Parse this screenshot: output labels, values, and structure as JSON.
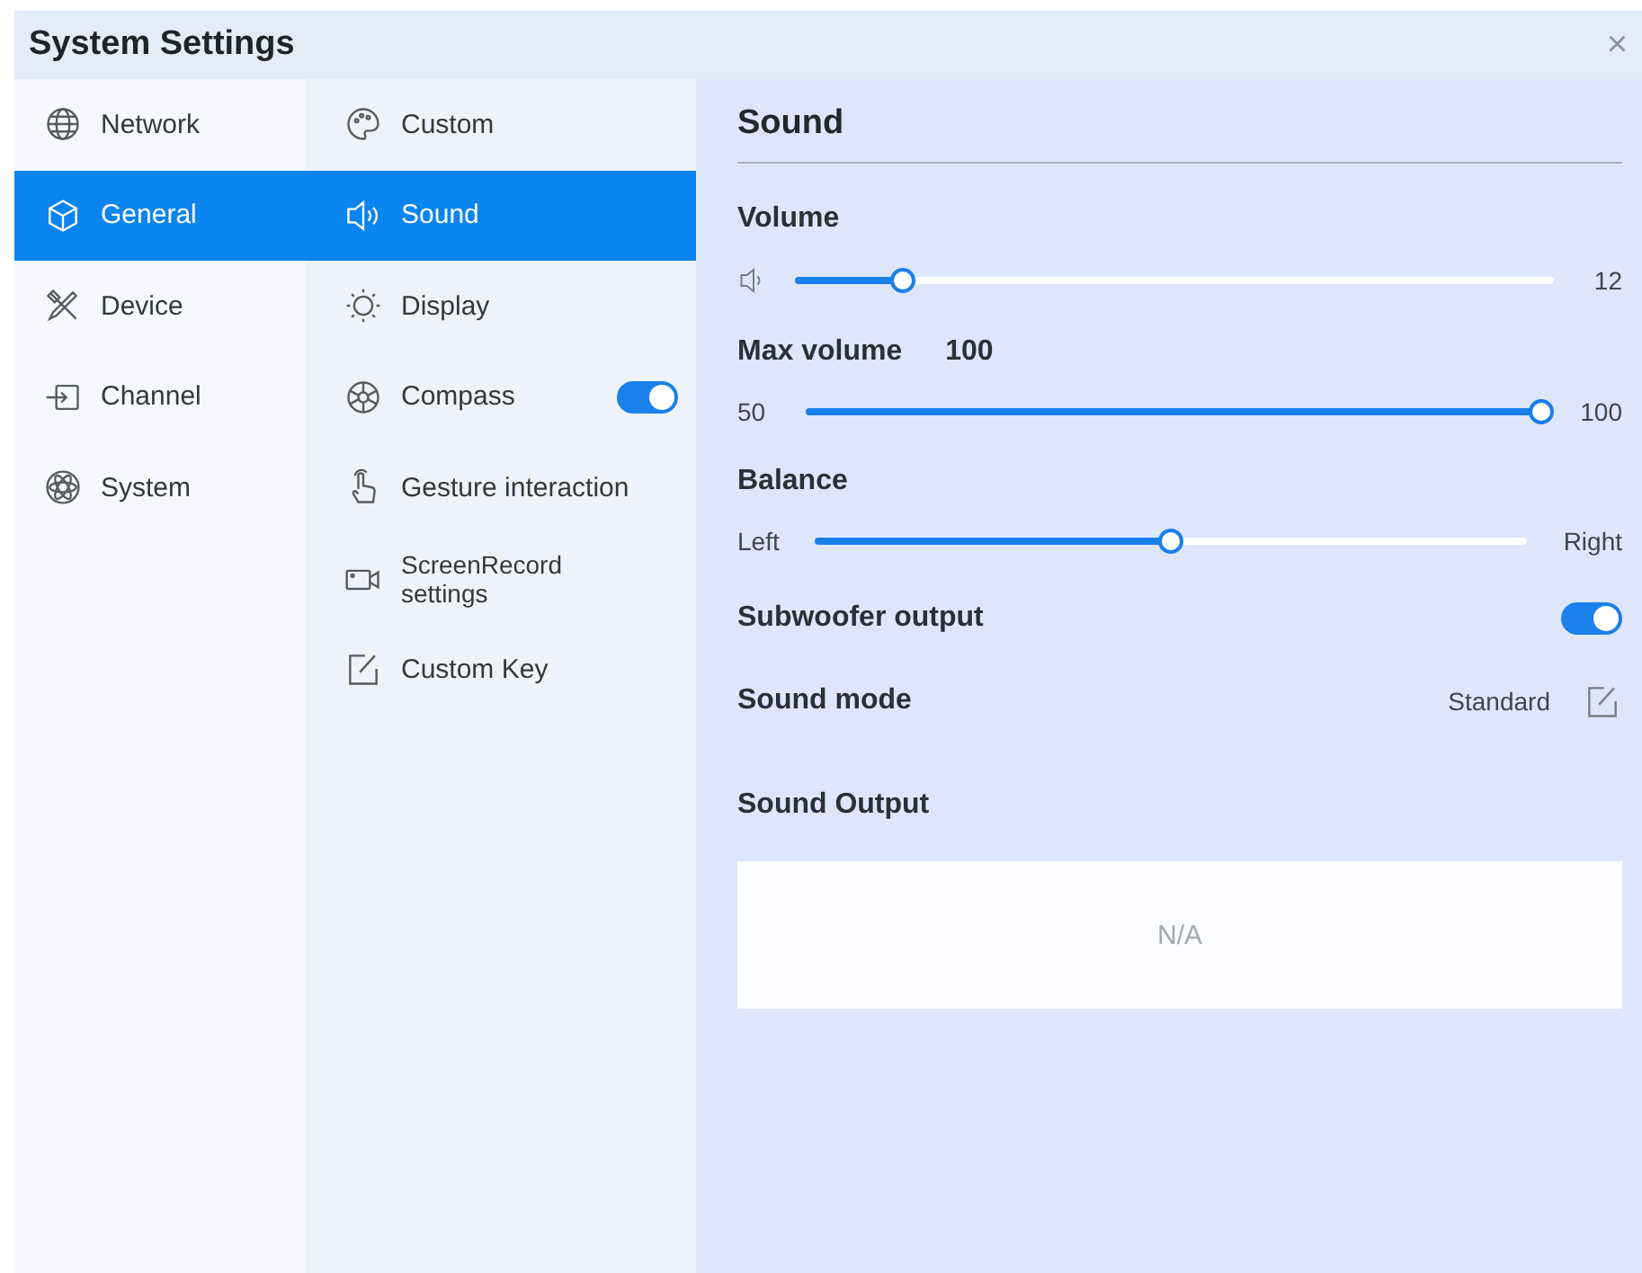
{
  "window": {
    "title": "System Settings",
    "close": "×"
  },
  "categories": [
    {
      "label": "Network",
      "selected": false
    },
    {
      "label": "General",
      "selected": true
    },
    {
      "label": "Device",
      "selected": false
    },
    {
      "label": "Channel",
      "selected": false
    },
    {
      "label": "System",
      "selected": false
    }
  ],
  "subitems": [
    {
      "label": "Custom",
      "kind": "link",
      "selected": false
    },
    {
      "label": "Sound",
      "kind": "link",
      "selected": true
    },
    {
      "label": "Display",
      "kind": "link",
      "selected": false
    },
    {
      "label": "Compass",
      "kind": "toggle",
      "selected": false,
      "on": true
    },
    {
      "label": "Gesture interaction",
      "kind": "link",
      "selected": false
    },
    {
      "label": "ScreenRecord settings",
      "kind": "link",
      "selected": false
    },
    {
      "label": "Custom Key",
      "kind": "link",
      "selected": false
    }
  ],
  "panel": {
    "title": "Sound",
    "volume": {
      "label": "Volume",
      "level": 0.13,
      "reading": "12"
    },
    "max_volume": {
      "label": "Max volume",
      "value": "100",
      "min_label": "50",
      "max_label": "100",
      "level": 1.0
    },
    "balance": {
      "label": "Balance",
      "left_label": "Left",
      "right_label": "Right",
      "level": 0.5
    },
    "subwoofer": {
      "label": "Subwoofer output",
      "on": true
    },
    "sound_mode": {
      "label": "Sound mode",
      "value": "Standard"
    },
    "sound_output": {
      "label": "Sound Output",
      "empty_text": "N/A"
    }
  }
}
